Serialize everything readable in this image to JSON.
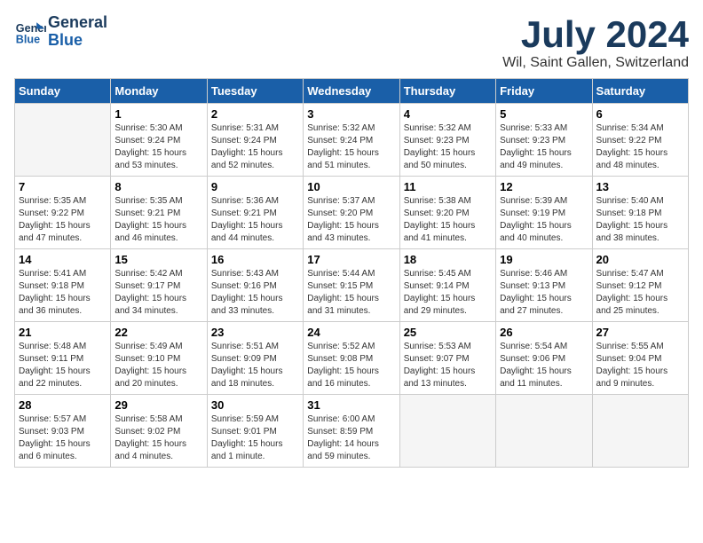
{
  "logo": {
    "line1": "General",
    "line2": "Blue"
  },
  "title": "July 2024",
  "location": "Wil, Saint Gallen, Switzerland",
  "weekdays": [
    "Sunday",
    "Monday",
    "Tuesday",
    "Wednesday",
    "Thursday",
    "Friday",
    "Saturday"
  ],
  "weeks": [
    [
      {
        "day": "",
        "info": ""
      },
      {
        "day": "1",
        "info": "Sunrise: 5:30 AM\nSunset: 9:24 PM\nDaylight: 15 hours\nand 53 minutes."
      },
      {
        "day": "2",
        "info": "Sunrise: 5:31 AM\nSunset: 9:24 PM\nDaylight: 15 hours\nand 52 minutes."
      },
      {
        "day": "3",
        "info": "Sunrise: 5:32 AM\nSunset: 9:24 PM\nDaylight: 15 hours\nand 51 minutes."
      },
      {
        "day": "4",
        "info": "Sunrise: 5:32 AM\nSunset: 9:23 PM\nDaylight: 15 hours\nand 50 minutes."
      },
      {
        "day": "5",
        "info": "Sunrise: 5:33 AM\nSunset: 9:23 PM\nDaylight: 15 hours\nand 49 minutes."
      },
      {
        "day": "6",
        "info": "Sunrise: 5:34 AM\nSunset: 9:22 PM\nDaylight: 15 hours\nand 48 minutes."
      }
    ],
    [
      {
        "day": "7",
        "info": "Sunrise: 5:35 AM\nSunset: 9:22 PM\nDaylight: 15 hours\nand 47 minutes."
      },
      {
        "day": "8",
        "info": "Sunrise: 5:35 AM\nSunset: 9:21 PM\nDaylight: 15 hours\nand 46 minutes."
      },
      {
        "day": "9",
        "info": "Sunrise: 5:36 AM\nSunset: 9:21 PM\nDaylight: 15 hours\nand 44 minutes."
      },
      {
        "day": "10",
        "info": "Sunrise: 5:37 AM\nSunset: 9:20 PM\nDaylight: 15 hours\nand 43 minutes."
      },
      {
        "day": "11",
        "info": "Sunrise: 5:38 AM\nSunset: 9:20 PM\nDaylight: 15 hours\nand 41 minutes."
      },
      {
        "day": "12",
        "info": "Sunrise: 5:39 AM\nSunset: 9:19 PM\nDaylight: 15 hours\nand 40 minutes."
      },
      {
        "day": "13",
        "info": "Sunrise: 5:40 AM\nSunset: 9:18 PM\nDaylight: 15 hours\nand 38 minutes."
      }
    ],
    [
      {
        "day": "14",
        "info": "Sunrise: 5:41 AM\nSunset: 9:18 PM\nDaylight: 15 hours\nand 36 minutes."
      },
      {
        "day": "15",
        "info": "Sunrise: 5:42 AM\nSunset: 9:17 PM\nDaylight: 15 hours\nand 34 minutes."
      },
      {
        "day": "16",
        "info": "Sunrise: 5:43 AM\nSunset: 9:16 PM\nDaylight: 15 hours\nand 33 minutes."
      },
      {
        "day": "17",
        "info": "Sunrise: 5:44 AM\nSunset: 9:15 PM\nDaylight: 15 hours\nand 31 minutes."
      },
      {
        "day": "18",
        "info": "Sunrise: 5:45 AM\nSunset: 9:14 PM\nDaylight: 15 hours\nand 29 minutes."
      },
      {
        "day": "19",
        "info": "Sunrise: 5:46 AM\nSunset: 9:13 PM\nDaylight: 15 hours\nand 27 minutes."
      },
      {
        "day": "20",
        "info": "Sunrise: 5:47 AM\nSunset: 9:12 PM\nDaylight: 15 hours\nand 25 minutes."
      }
    ],
    [
      {
        "day": "21",
        "info": "Sunrise: 5:48 AM\nSunset: 9:11 PM\nDaylight: 15 hours\nand 22 minutes."
      },
      {
        "day": "22",
        "info": "Sunrise: 5:49 AM\nSunset: 9:10 PM\nDaylight: 15 hours\nand 20 minutes."
      },
      {
        "day": "23",
        "info": "Sunrise: 5:51 AM\nSunset: 9:09 PM\nDaylight: 15 hours\nand 18 minutes."
      },
      {
        "day": "24",
        "info": "Sunrise: 5:52 AM\nSunset: 9:08 PM\nDaylight: 15 hours\nand 16 minutes."
      },
      {
        "day": "25",
        "info": "Sunrise: 5:53 AM\nSunset: 9:07 PM\nDaylight: 15 hours\nand 13 minutes."
      },
      {
        "day": "26",
        "info": "Sunrise: 5:54 AM\nSunset: 9:06 PM\nDaylight: 15 hours\nand 11 minutes."
      },
      {
        "day": "27",
        "info": "Sunrise: 5:55 AM\nSunset: 9:04 PM\nDaylight: 15 hours\nand 9 minutes."
      }
    ],
    [
      {
        "day": "28",
        "info": "Sunrise: 5:57 AM\nSunset: 9:03 PM\nDaylight: 15 hours\nand 6 minutes."
      },
      {
        "day": "29",
        "info": "Sunrise: 5:58 AM\nSunset: 9:02 PM\nDaylight: 15 hours\nand 4 minutes."
      },
      {
        "day": "30",
        "info": "Sunrise: 5:59 AM\nSunset: 9:01 PM\nDaylight: 15 hours\nand 1 minute."
      },
      {
        "day": "31",
        "info": "Sunrise: 6:00 AM\nSunset: 8:59 PM\nDaylight: 14 hours\nand 59 minutes."
      },
      {
        "day": "",
        "info": ""
      },
      {
        "day": "",
        "info": ""
      },
      {
        "day": "",
        "info": ""
      }
    ]
  ]
}
